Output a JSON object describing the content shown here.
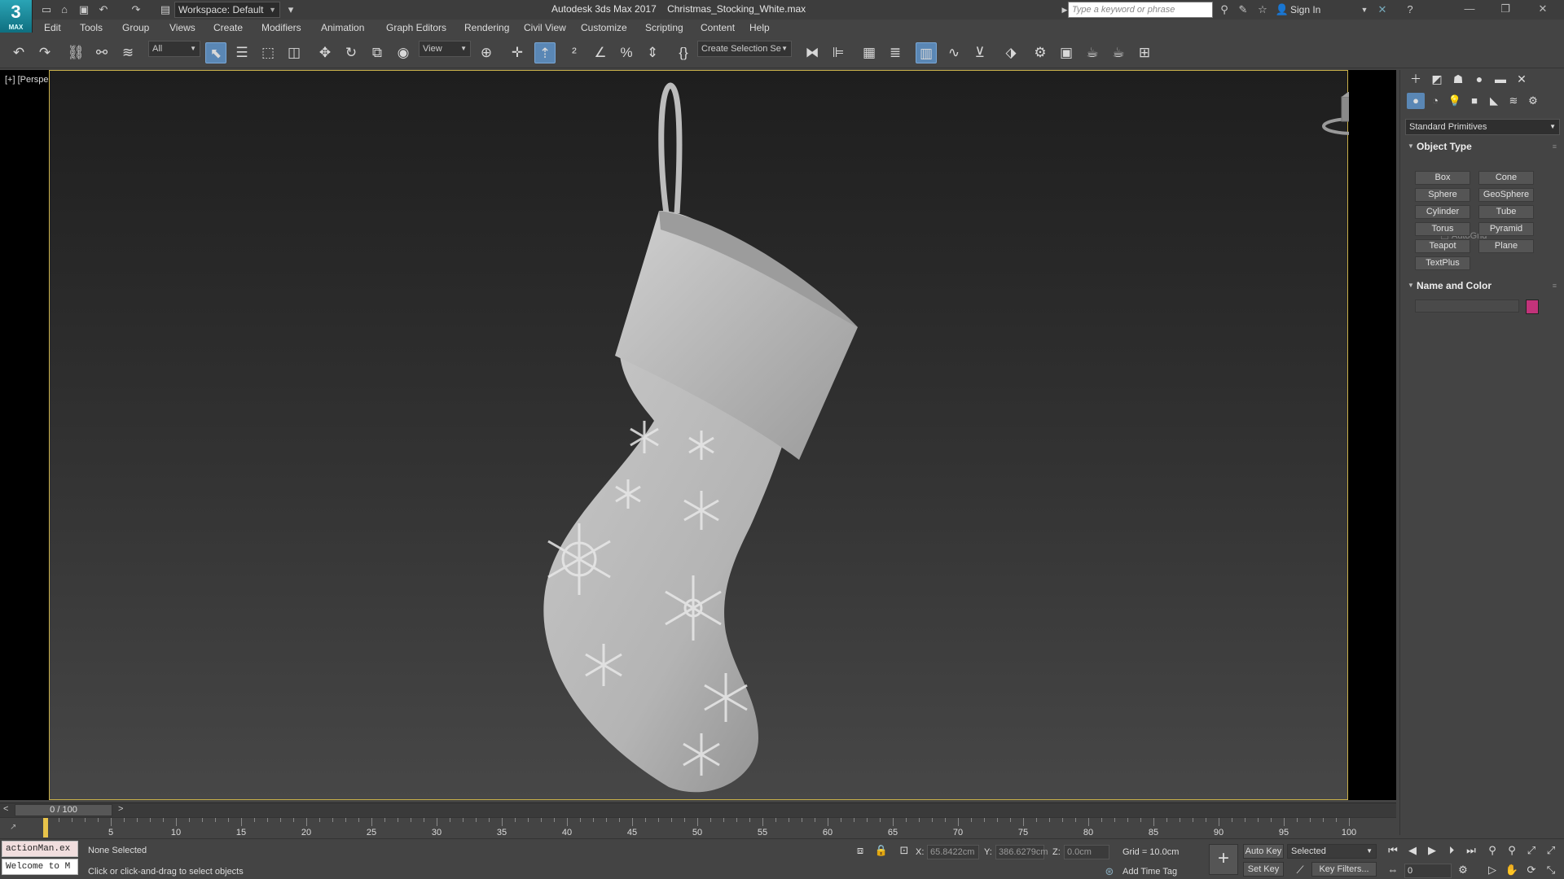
{
  "app": {
    "logo_text": "3",
    "logo_sub": "MAX",
    "title": "Autodesk 3ds Max 2017",
    "filename": "Christmas_Stocking_White.max",
    "workspace": "Workspace: Default",
    "search_placeholder": "Type a keyword or phrase",
    "sign_in": "Sign In"
  },
  "menu": [
    "Edit",
    "Tools",
    "Group",
    "Views",
    "Create",
    "Modifiers",
    "Animation",
    "Graph Editors",
    "Rendering",
    "Civil View",
    "Customize",
    "Scripting",
    "Content",
    "Help"
  ],
  "toolbar": {
    "selection_filter": "All",
    "ref_coord": "View",
    "named_selection": "Create Selection Se"
  },
  "viewport": {
    "label": "[+] [Perspective ] [User Defined ] [Default Shading ]",
    "border_color": "#c9b04a"
  },
  "command_panel": {
    "dropdown": "Standard Primitives",
    "object_type_title": "Object Type",
    "autogrid": "AutoGrid",
    "buttons": [
      "Box",
      "Cone",
      "Sphere",
      "GeoSphere",
      "Cylinder",
      "Tube",
      "Torus",
      "Pyramid",
      "Teapot",
      "Plane",
      "TextPlus"
    ],
    "name_color_title": "Name and Color",
    "color": "#c2337a"
  },
  "timeline": {
    "frame": "0 / 100",
    "ticks": [
      "5",
      "10",
      "15",
      "20",
      "25",
      "30",
      "35",
      "40",
      "45",
      "50",
      "55",
      "60",
      "65",
      "70",
      "75",
      "80",
      "85",
      "90",
      "95",
      "100"
    ]
  },
  "status": {
    "listener_1": "actionMan.ex",
    "listener_2": "Welcome to M",
    "selection": "None Selected",
    "prompt": "Click or click-and-drag to select objects",
    "x_label": "X:",
    "x_value": "65.8422cm",
    "y_label": "Y:",
    "y_value": "386.6279cm",
    "z_label": "Z:",
    "z_value": "0.0cm",
    "grid": "Grid = 10.0cm",
    "add_time_tag": "Add Time Tag",
    "auto_key": "Auto Key",
    "set_key": "Set Key",
    "key_mode": "Selected",
    "key_filters": "Key Filters...",
    "frame_field": "0"
  }
}
